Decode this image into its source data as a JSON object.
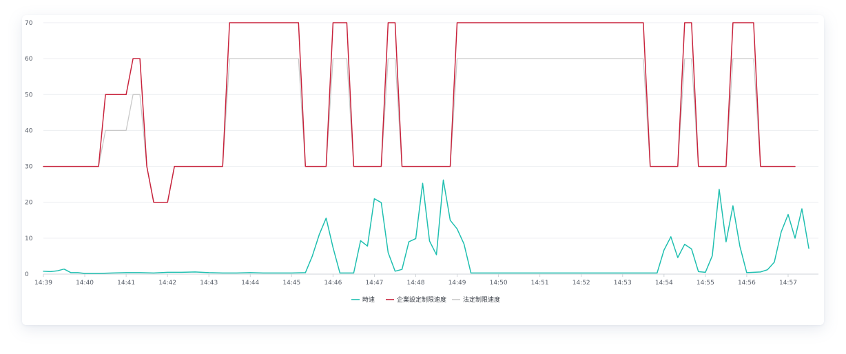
{
  "chart_data": {
    "type": "line",
    "ylim": [
      0,
      70
    ],
    "yticks": [
      0,
      10,
      20,
      30,
      40,
      50,
      60,
      70
    ],
    "xlim": [
      "14:39",
      "14:57:40"
    ],
    "xticks": [
      "14:39",
      "14:40",
      "14:41",
      "14:42",
      "14:43",
      "14:44",
      "14:45",
      "14:46",
      "14:47",
      "14:48",
      "14:49",
      "14:50",
      "14:51",
      "14:52",
      "14:53",
      "14:54",
      "14:55",
      "14:56",
      "14:57"
    ],
    "grid": "horizontal",
    "legend_position": "bottom-center",
    "series": [
      {
        "name": "時速",
        "color": "#1fbfb0",
        "points": [
          [
            "14:39:00",
            0.8
          ],
          [
            "14:39:10",
            0.7
          ],
          [
            "14:39:20",
            0.9
          ],
          [
            "14:39:30",
            1.4
          ],
          [
            "14:39:40",
            0.4
          ],
          [
            "14:39:50",
            0.4
          ],
          [
            "14:40:00",
            0.2
          ],
          [
            "14:40:20",
            0.2
          ],
          [
            "14:40:40",
            0.3
          ],
          [
            "14:41:00",
            0.4
          ],
          [
            "14:41:20",
            0.4
          ],
          [
            "14:41:40",
            0.3
          ],
          [
            "14:42:00",
            0.5
          ],
          [
            "14:42:20",
            0.5
          ],
          [
            "14:42:40",
            0.6
          ],
          [
            "14:43:00",
            0.4
          ],
          [
            "14:43:20",
            0.3
          ],
          [
            "14:43:40",
            0.3
          ],
          [
            "14:44:00",
            0.4
          ],
          [
            "14:44:20",
            0.3
          ],
          [
            "14:44:40",
            0.3
          ],
          [
            "14:45:00",
            0.3
          ],
          [
            "14:45:20",
            0.4
          ],
          [
            "14:45:30",
            5.0
          ],
          [
            "14:45:40",
            11.0
          ],
          [
            "14:45:50",
            15.6
          ],
          [
            "14:46:00",
            7.4
          ],
          [
            "14:46:10",
            0.3
          ],
          [
            "14:46:30",
            0.3
          ],
          [
            "14:46:40",
            9.3
          ],
          [
            "14:46:50",
            7.8
          ],
          [
            "14:47:00",
            21.0
          ],
          [
            "14:47:10",
            19.9
          ],
          [
            "14:47:20",
            6.0
          ],
          [
            "14:47:30",
            0.8
          ],
          [
            "14:47:40",
            1.3
          ],
          [
            "14:47:50",
            9.0
          ],
          [
            "14:48:00",
            9.9
          ],
          [
            "14:48:10",
            25.3
          ],
          [
            "14:48:20",
            9.2
          ],
          [
            "14:48:30",
            5.4
          ],
          [
            "14:48:40",
            26.2
          ],
          [
            "14:48:50",
            15.0
          ],
          [
            "14:49:00",
            12.6
          ],
          [
            "14:49:10",
            8.4
          ],
          [
            "14:49:20",
            0.3
          ],
          [
            "14:50:00",
            0.3
          ],
          [
            "14:51:00",
            0.3
          ],
          [
            "14:52:00",
            0.3
          ],
          [
            "14:53:00",
            0.3
          ],
          [
            "14:53:50",
            0.3
          ],
          [
            "14:54:00",
            6.7
          ],
          [
            "14:54:10",
            10.4
          ],
          [
            "14:54:20",
            4.6
          ],
          [
            "14:54:30",
            8.3
          ],
          [
            "14:54:40",
            7.0
          ],
          [
            "14:54:50",
            0.7
          ],
          [
            "14:55:00",
            0.5
          ],
          [
            "14:55:10",
            5.1
          ],
          [
            "14:55:20",
            23.6
          ],
          [
            "14:55:30",
            9.0
          ],
          [
            "14:55:40",
            19.0
          ],
          [
            "14:55:50",
            7.8
          ],
          [
            "14:56:00",
            0.4
          ],
          [
            "14:56:20",
            0.6
          ],
          [
            "14:56:30",
            1.2
          ],
          [
            "14:56:40",
            3.3
          ],
          [
            "14:56:50",
            11.8
          ],
          [
            "14:57:00",
            16.6
          ],
          [
            "14:57:10",
            10.0
          ],
          [
            "14:57:20",
            18.2
          ],
          [
            "14:57:30",
            7.2
          ]
        ]
      },
      {
        "name": "企業設定制限速度",
        "color": "#c8233c",
        "points": [
          [
            "14:39:00",
            30
          ],
          [
            "14:40:20",
            30
          ],
          [
            "14:40:30",
            50
          ],
          [
            "14:41:00",
            50
          ],
          [
            "14:41:10",
            60
          ],
          [
            "14:41:20",
            60
          ],
          [
            "14:41:30",
            30
          ],
          [
            "14:41:40",
            20
          ],
          [
            "14:42:00",
            20
          ],
          [
            "14:42:10",
            30
          ],
          [
            "14:43:20",
            30
          ],
          [
            "14:43:30",
            70
          ],
          [
            "14:45:10",
            70
          ],
          [
            "14:45:20",
            30
          ],
          [
            "14:45:50",
            30
          ],
          [
            "14:46:00",
            70
          ],
          [
            "14:46:20",
            70
          ],
          [
            "14:46:30",
            30
          ],
          [
            "14:47:10",
            30
          ],
          [
            "14:47:20",
            70
          ],
          [
            "14:47:30",
            70
          ],
          [
            "14:47:40",
            30
          ],
          [
            "14:48:50",
            30
          ],
          [
            "14:49:00",
            70
          ],
          [
            "14:53:30",
            70
          ],
          [
            "14:53:40",
            30
          ],
          [
            "14:54:20",
            30
          ],
          [
            "14:54:30",
            70
          ],
          [
            "14:54:40",
            70
          ],
          [
            "14:54:50",
            30
          ],
          [
            "14:55:30",
            30
          ],
          [
            "14:55:40",
            70
          ],
          [
            "14:56:10",
            70
          ],
          [
            "14:56:20",
            30
          ],
          [
            "14:57:10",
            30
          ]
        ]
      },
      {
        "name": "法定制限速度",
        "color": "#c9c9c9",
        "points": [
          [
            "14:39:00",
            30
          ],
          [
            "14:40:20",
            30
          ],
          [
            "14:40:30",
            40
          ],
          [
            "14:41:00",
            40
          ],
          [
            "14:41:10",
            50
          ],
          [
            "14:41:20",
            50
          ],
          [
            "14:41:30",
            30
          ],
          [
            "14:41:40",
            20
          ],
          [
            "14:42:00",
            20
          ],
          [
            "14:42:10",
            30
          ],
          [
            "14:43:20",
            30
          ],
          [
            "14:43:30",
            60
          ],
          [
            "14:45:10",
            60
          ],
          [
            "14:45:20",
            30
          ],
          [
            "14:45:50",
            30
          ],
          [
            "14:46:00",
            60
          ],
          [
            "14:46:20",
            60
          ],
          [
            "14:46:30",
            30
          ],
          [
            "14:47:10",
            30
          ],
          [
            "14:47:20",
            60
          ],
          [
            "14:47:30",
            60
          ],
          [
            "14:47:40",
            30
          ],
          [
            "14:48:50",
            30
          ],
          [
            "14:49:00",
            60
          ],
          [
            "14:53:30",
            60
          ],
          [
            "14:53:40",
            30
          ],
          [
            "14:54:20",
            30
          ],
          [
            "14:54:30",
            60
          ],
          [
            "14:54:40",
            60
          ],
          [
            "14:54:50",
            30
          ],
          [
            "14:55:30",
            30
          ],
          [
            "14:55:40",
            60
          ],
          [
            "14:56:10",
            60
          ],
          [
            "14:56:20",
            30
          ],
          [
            "14:57:10",
            30
          ]
        ]
      }
    ]
  }
}
